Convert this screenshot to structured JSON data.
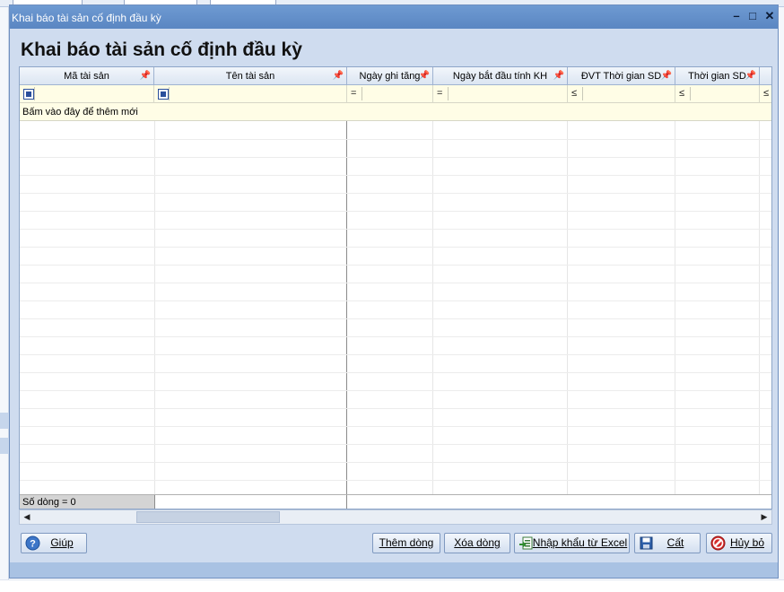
{
  "dialog": {
    "title": "Khai báo tài sản cố định đầu kỳ",
    "heading": "Khai báo tài sản cố định đầu kỳ"
  },
  "window_controls": {
    "minimize": "–",
    "maximize": "□",
    "close": "✕"
  },
  "grid": {
    "columns": [
      {
        "label": "Mã tài sản",
        "filter": "checkbox"
      },
      {
        "label": "Tên tài sản",
        "filter": "checkbox"
      },
      {
        "label": "Ngày ghi tăng",
        "filter": "="
      },
      {
        "label": "Ngày bắt đầu tính KH",
        "filter": "="
      },
      {
        "label": "ĐVT Thời gian SD",
        "filter": "≤"
      },
      {
        "label": "Thời gian SD",
        "filter": "≤"
      },
      {
        "label": "",
        "filter": "≤"
      }
    ],
    "pin_icon": "📌",
    "add_row_text": "Bấm vào đây để thêm mới",
    "row_count_text": "Số dòng = 0"
  },
  "buttons": {
    "help": "Giúp",
    "add_row": "Thêm dòng",
    "delete_row": "Xóa dòng",
    "import_excel": "Nhập khẩu từ Excel",
    "save": "Cất",
    "cancel": "Hủy bỏ"
  },
  "colors": {
    "titlebar": "#5a86c2",
    "filter_row": "#fffde6",
    "dialog_bg": "#cfdcef"
  }
}
